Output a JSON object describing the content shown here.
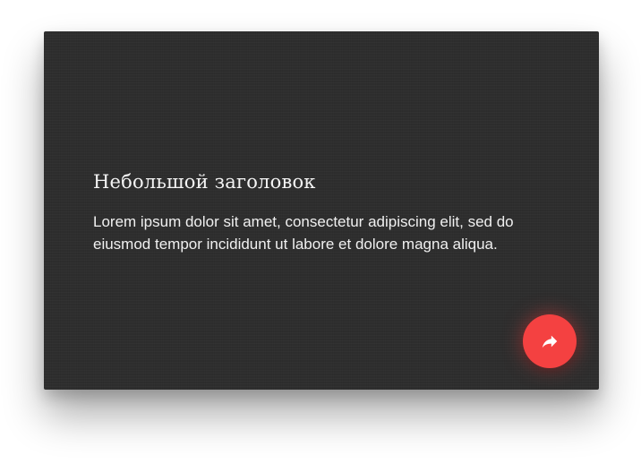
{
  "card": {
    "title": "Небольшой заголовок",
    "text": "Lorem ipsum dolor sit amet, consectetur adipiscing elit, sed do eiusmod tempor incididunt ut labore et dolore magna aliqua.",
    "share_button": {
      "icon": "share-arrow-icon",
      "color": "#f44141"
    },
    "background_color": "#2e2e2e"
  }
}
